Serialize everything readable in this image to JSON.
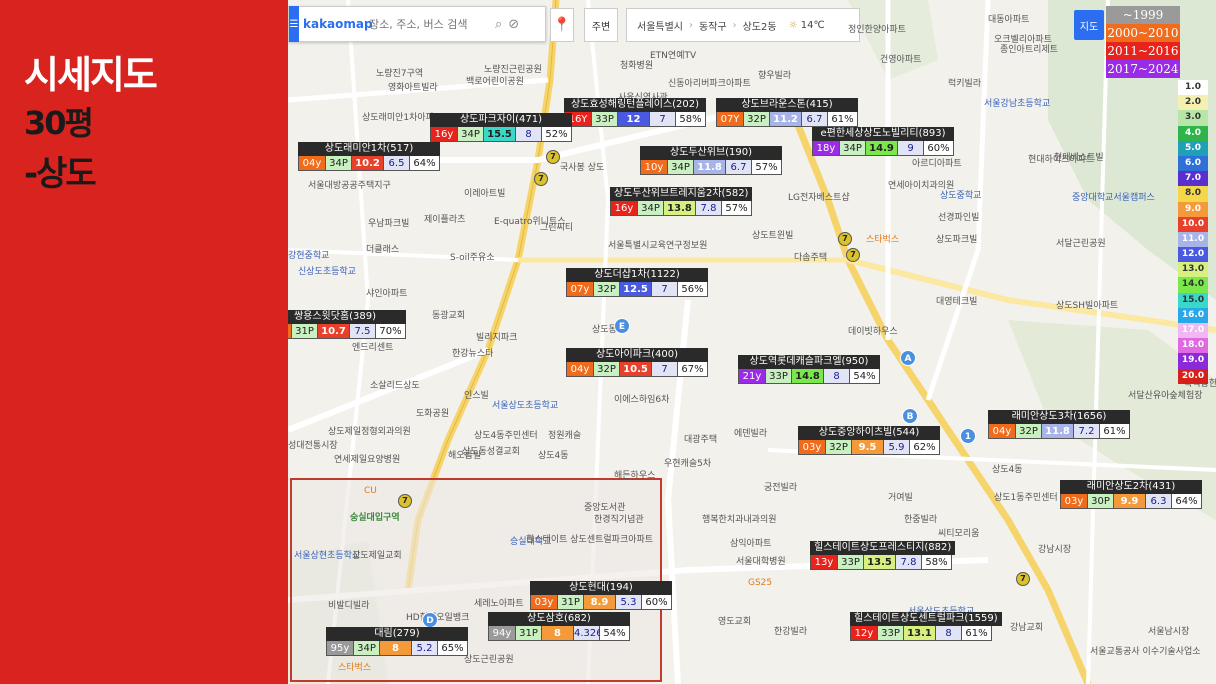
{
  "title": {
    "line1": "시세지도",
    "line2": "30평",
    "line3": "-상도"
  },
  "toolbar": {
    "logo": "kakaomap",
    "search_placeholder": "장소, 주소, 버스 검색",
    "nearby_label": "주변",
    "breadcrumb": [
      "서울특별시",
      "동작구",
      "상도2동"
    ],
    "weather": "14℃",
    "map_type_label": "지도"
  },
  "year_legend": [
    {
      "label": "~1999",
      "color": "#9a9a9a"
    },
    {
      "label": "2000~2010",
      "color": "#f06b1c"
    },
    {
      "label": "2011~2016",
      "color": "#e8231c"
    },
    {
      "label": "2017~2024",
      "color": "#9a2be6"
    }
  ],
  "ratio_legend": [
    {
      "label": "1.0",
      "color": "#ffffff",
      "text": "#333"
    },
    {
      "label": "2.0",
      "color": "#f5f0b0",
      "text": "#333"
    },
    {
      "label": "3.0",
      "color": "#b8e6a8",
      "text": "#333"
    },
    {
      "label": "4.0",
      "color": "#2fb34a",
      "text": "#fff"
    },
    {
      "label": "5.0",
      "color": "#1f9fb8",
      "text": "#fff"
    },
    {
      "label": "6.0",
      "color": "#2e6fd8",
      "text": "#fff"
    },
    {
      "label": "7.0",
      "color": "#5a2fd0",
      "text": "#fff"
    },
    {
      "label": "8.0",
      "color": "#f5d84a",
      "text": "#333"
    },
    {
      "label": "9.0",
      "color": "#f59a3a",
      "text": "#fff"
    },
    {
      "label": "10.0",
      "color": "#e8402a",
      "text": "#fff"
    },
    {
      "label": "11.0",
      "color": "#a8b4e8",
      "text": "#fff"
    },
    {
      "label": "12.0",
      "color": "#4a5ae0",
      "text": "#fff"
    },
    {
      "label": "13.0",
      "color": "#d8f080",
      "text": "#333"
    },
    {
      "label": "14.0",
      "color": "#7ae84a",
      "text": "#333"
    },
    {
      "label": "15.0",
      "color": "#3ad8c8",
      "text": "#333"
    },
    {
      "label": "16.0",
      "color": "#28a8e8",
      "text": "#fff"
    },
    {
      "label": "17.0",
      "color": "#f0b8f0",
      "text": "#fff"
    },
    {
      "label": "18.0",
      "color": "#e068e0",
      "text": "#fff"
    },
    {
      "label": "19.0",
      "color": "#8a2ad8",
      "text": "#fff"
    },
    {
      "label": "20.0",
      "color": "#d8201a",
      "text": "#fff"
    }
  ],
  "apartments": [
    {
      "name": "상도효성해링턴플레이스(202)",
      "age": "16Y",
      "age_color": "#e8231c",
      "size": "33P",
      "ratio": "12",
      "ratio_color": "#4a5ae0",
      "ratio_text": "#fff",
      "price": "7",
      "pct": "58%"
    },
    {
      "name": "상도파크자이(471)",
      "age": "16y",
      "age_color": "#e8231c",
      "size": "34P",
      "ratio": "15.5",
      "ratio_color": "#3ad8c8",
      "ratio_text": "#222",
      "price": "8",
      "pct": "52%"
    },
    {
      "name": "상도브라운스톤(415)",
      "age": "07Y",
      "age_color": "#f06b1c",
      "size": "32P",
      "ratio": "11.2",
      "ratio_color": "#a8b4e8",
      "ratio_text": "#fff",
      "price": "6.7",
      "pct": "61%"
    },
    {
      "name": "e편한세상상도노빌리티(893)",
      "age": "18y",
      "age_color": "#9a2be6",
      "size": "34P",
      "ratio": "14.9",
      "ratio_color": "#7ae84a",
      "ratio_text": "#222",
      "price": "9",
      "pct": "60%"
    },
    {
      "name": "상도래미안1차(517)",
      "age": "04y",
      "age_color": "#f06b1c",
      "size": "34P",
      "ratio": "10.2",
      "ratio_color": "#e8402a",
      "ratio_text": "#fff",
      "price": "6.5",
      "pct": "64%"
    },
    {
      "name": "상도두산위브(190)",
      "age": "10y",
      "age_color": "#f06b1c",
      "size": "34P",
      "ratio": "11.8",
      "ratio_color": "#a8b4e8",
      "ratio_text": "#fff",
      "price": "6.7",
      "pct": "57%"
    },
    {
      "name": "상도두산위브트레지움2차(582)",
      "age": "16y",
      "age_color": "#e8231c",
      "size": "34P",
      "ratio": "13.8",
      "ratio_color": "#d8f080",
      "ratio_text": "#222",
      "price": "7.8",
      "pct": "57%"
    },
    {
      "name": "상도더샵1차(1122)",
      "age": "07y",
      "age_color": "#f06b1c",
      "size": "32P",
      "ratio": "12.5",
      "ratio_color": "#4a5ae0",
      "ratio_text": "#fff",
      "price": "7",
      "pct": "56%"
    },
    {
      "name": "쌍용스윗닷홈(389)",
      "age": "03y",
      "age_color": "#f06b1c",
      "size": "31P",
      "ratio": "10.7",
      "ratio_color": "#e8402a",
      "ratio_text": "#fff",
      "price": "7.5",
      "pct": "70%"
    },
    {
      "name": "상도아이파크(400)",
      "age": "04y",
      "age_color": "#f06b1c",
      "size": "32P",
      "ratio": "10.5",
      "ratio_color": "#e8402a",
      "ratio_text": "#fff",
      "price": "7",
      "pct": "67%"
    },
    {
      "name": "상도역롯데캐슬파크엘(950)",
      "age": "21y",
      "age_color": "#9a2be6",
      "size": "33P",
      "ratio": "14.8",
      "ratio_color": "#7ae84a",
      "ratio_text": "#222",
      "price": "8",
      "pct": "54%"
    },
    {
      "name": "래미안상도3차(1656)",
      "age": "04y",
      "age_color": "#f06b1c",
      "size": "32P",
      "ratio": "11.8",
      "ratio_color": "#a8b4e8",
      "ratio_text": "#fff",
      "price": "7.2",
      "pct": "61%"
    },
    {
      "name": "상도중앙하이츠빌(544)",
      "age": "03y",
      "age_color": "#f06b1c",
      "size": "32P",
      "ratio": "9.5",
      "ratio_color": "#f59a3a",
      "ratio_text": "#fff",
      "price": "5.9",
      "pct": "62%"
    },
    {
      "name": "래미안상도2차(431)",
      "age": "03y",
      "age_color": "#f06b1c",
      "size": "30P",
      "ratio": "9.9",
      "ratio_color": "#f59a3a",
      "ratio_text": "#fff",
      "price": "6.3",
      "pct": "64%"
    },
    {
      "name": "힐스테이트상도프레스티지(882)",
      "age": "13y",
      "age_color": "#e8231c",
      "size": "33P",
      "ratio": "13.5",
      "ratio_color": "#d8f080",
      "ratio_text": "#222",
      "price": "7.8",
      "pct": "58%"
    },
    {
      "name": "상도현대(194)",
      "age": "03y",
      "age_color": "#f06b1c",
      "size": "31P",
      "ratio": "8.9",
      "ratio_color": "#f59a3a",
      "ratio_text": "#fff",
      "price": "5.3",
      "pct": "60%"
    },
    {
      "name": "상도삼호(682)",
      "age": "94y",
      "age_color": "#9a9a9a",
      "size": "31P",
      "ratio": "8",
      "ratio_color": "#f59a3a",
      "ratio_text": "#fff",
      "price": "4.326",
      "pct": "54%"
    },
    {
      "name": "대림(279)",
      "age": "95y",
      "age_color": "#9a9a9a",
      "size": "34P",
      "ratio": "8",
      "ratio_color": "#f59a3a",
      "ratio_text": "#fff",
      "price": "5.2",
      "pct": "65%"
    },
    {
      "name": "힐스테이트상도센트럴파크(1559)",
      "age": "12y",
      "age_color": "#e8231c",
      "size": "33P",
      "ratio": "13.1",
      "ratio_color": "#d8f080",
      "ratio_text": "#222",
      "price": "8",
      "pct": "61%"
    }
  ],
  "places": [
    "노량진7구역",
    "영화아트빌라",
    "백로어린이공원",
    "노량진근린공원",
    "ETN연예TV",
    "청화병원",
    "신동아리버파크아파트",
    "사육신역사관",
    "향우빌라",
    "정인한양아파트",
    "대동아파트",
    "오크벨리아파트",
    "종인아트리제트",
    "건영아파트",
    "럭키빌라",
    "서울강남초등학교",
    "현대하이츠아파트",
    "상도래미안1차아파트",
    "서울대방공공주택지구",
    "이레아트빌",
    "우남파크빌",
    "제이플라츠",
    "더클래스",
    "강현중학교",
    "E-quatro위니트스",
    "그린씨티",
    "S-oil주유소",
    "신상도초등학교",
    "서울특별시교육연구정보원",
    "LG전자베스트샵",
    "스타벅스",
    "상도트윈빌",
    "다솜주택",
    "아르디아파트",
    "연세아이치과의원",
    "현대베스트빌",
    "중앙대학교서울캠퍼스",
    "상도중학교",
    "선경파인빌",
    "상도파크빌",
    "서달근린공원",
    "샤인아파트",
    "동광교회",
    "빌리지파크",
    "한강뉴스타",
    "상도동",
    "국사봉 상도",
    "엔드리센트",
    "대영테크빌",
    "데이빗하우스",
    "상도SH빌아파트",
    "소살리드상도",
    "인스빌",
    "도화공원",
    "성대전통시장",
    "상도제일정형외과의원",
    "연세제일요양병원",
    "서울상도초등학교",
    "이에스하임6차",
    "상도4동주민센터",
    "상도동성결교회",
    "해오름빌",
    "정원캐슬",
    "상도4동",
    "대광주택",
    "우현캐슬5차",
    "에덴빌라",
    "해든하우스",
    "궁전빌라",
    "상도1동주민센터",
    "서달산유아숲체험장",
    "흑석동한아파트",
    "상도4동",
    "거여빌",
    "한중빌라",
    "씨티모리움",
    "강남시장",
    "행복한치과내과의원",
    "삼익아파트",
    "서울대학병원",
    "한강빌라",
    "영도교회",
    "강남교회",
    "서울남시장",
    "서울교통공사 이수기술사업소",
    "승실대학교",
    "중앙도서관",
    "한경직기념관",
    "힐스테이트 상도센트럴파크아파트",
    "서울상현초등학교",
    "상도제일교회",
    "비발디빌라",
    "HD현대오일뱅크",
    "세레노아파트",
    "상도근린공원",
    "스타벅스",
    "CU",
    "GS25",
    "서울상도초등학교"
  ],
  "inset": {
    "label": "숭실대입구역"
  }
}
